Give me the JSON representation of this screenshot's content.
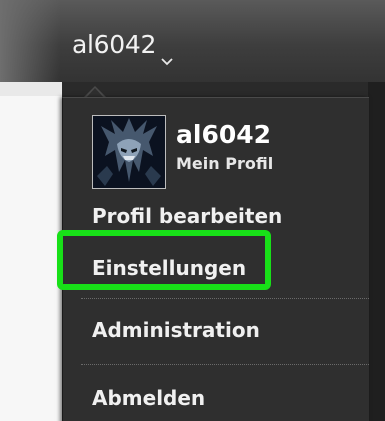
{
  "header": {
    "username": "al6042",
    "toggle_icon": "chevron-down-icon"
  },
  "profile": {
    "name": "al6042",
    "subtitle": "Mein Profil",
    "avatar_icon": "avatar-image"
  },
  "menu": {
    "edit_profile": "Profil bearbeiten",
    "settings": "Einstellungen",
    "administration": "Administration",
    "logout": "Abmelden"
  },
  "highlight": {
    "target": "settings",
    "color": "#18e018"
  }
}
